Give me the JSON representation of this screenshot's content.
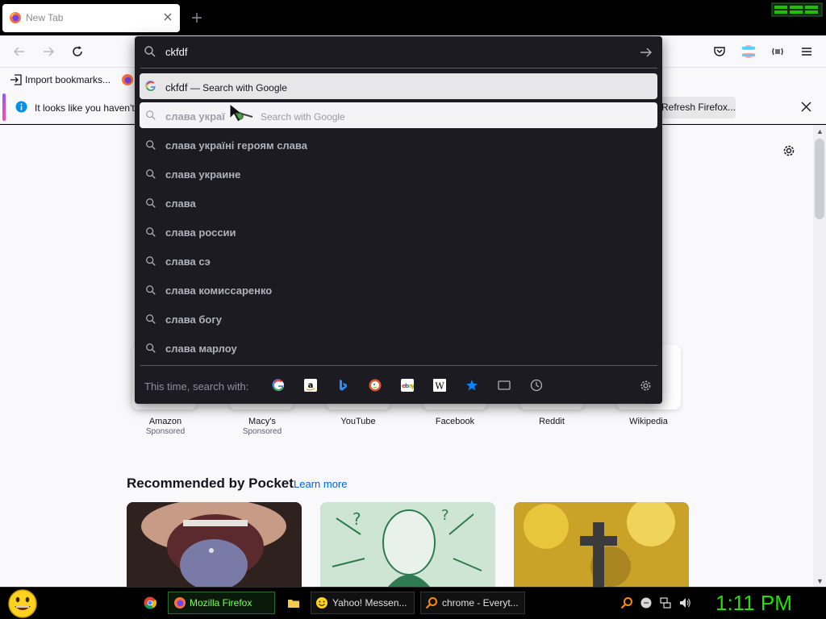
{
  "tab": {
    "title": "New Tab"
  },
  "bookmarks": {
    "import_label": "Import bookmarks..."
  },
  "notification": {
    "text": "It looks like you haven't",
    "refresh_label": "Refresh Firefox..."
  },
  "top_sites": [
    {
      "label": "Amazon",
      "sponsored": "Sponsored"
    },
    {
      "label": "Macy's",
      "sponsored": "Sponsored"
    },
    {
      "label": "YouTube"
    },
    {
      "label": "Facebook"
    },
    {
      "label": "Reddit"
    },
    {
      "label": "Wikipedia"
    }
  ],
  "pocket": {
    "title": "Recommended by Pocket",
    "learn_more": "Learn more"
  },
  "urlbar": {
    "input_value": "ckfdf",
    "results": [
      {
        "query": "ckfdf",
        "action": "— Search with Google"
      },
      {
        "query": "слава украї",
        "action": "Search with Google"
      },
      {
        "text": "слава україні героям слава"
      },
      {
        "text": "слава украине"
      },
      {
        "text": "слава"
      },
      {
        "text": "слава россии"
      },
      {
        "text": "слава сэ"
      },
      {
        "text": "слава комиссаренко"
      },
      {
        "text": "слава богу"
      },
      {
        "text": "слава марлоу"
      }
    ],
    "oneoff_label": "This time, search with:",
    "engines": [
      "google",
      "amazon",
      "bing",
      "duckduckgo",
      "ebay",
      "wikipedia",
      "bookmarks",
      "tabs",
      "history"
    ]
  },
  "taskbar": {
    "tasks": [
      {
        "label": "Mozilla Firefox"
      },
      {
        "label": "Yahoo! Messen..."
      },
      {
        "label": "chrome - Everyt..."
      }
    ],
    "clock": "1:11 PM"
  },
  "colors": {
    "urlbar_bg": "#1c1b22",
    "clock_green": "#22e000",
    "link_blue": "#0061e0"
  }
}
